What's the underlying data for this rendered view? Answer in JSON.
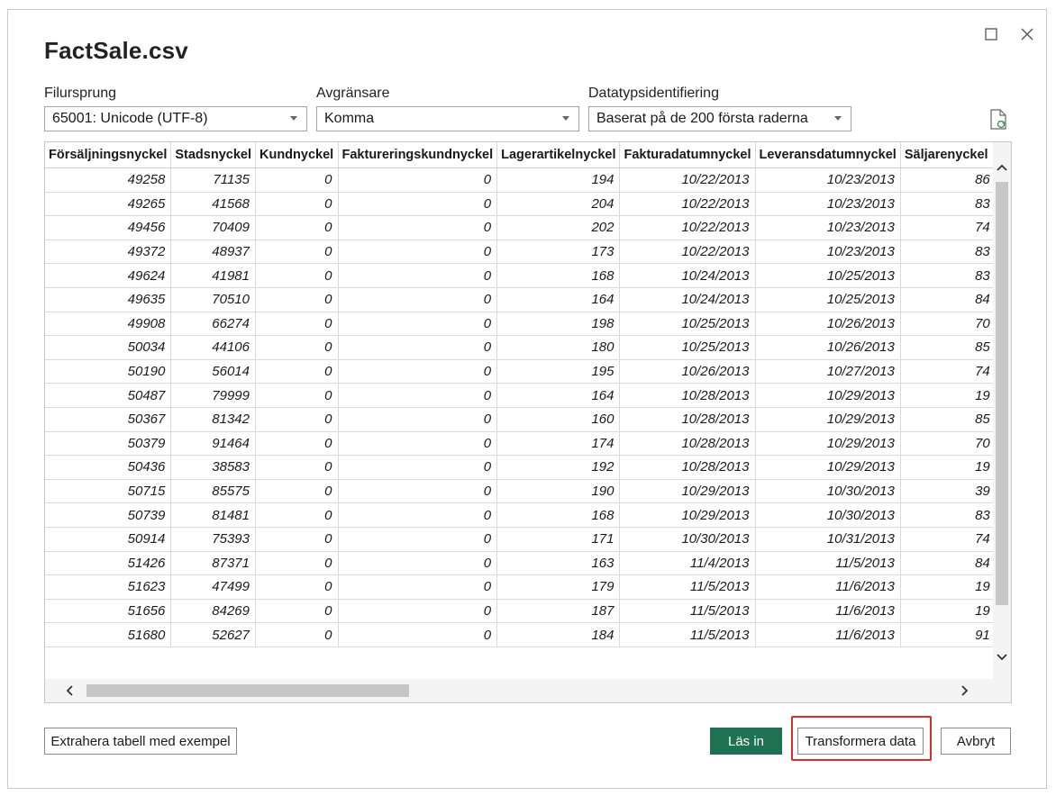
{
  "dialog": {
    "title": "FactSale.csv",
    "file_origin": {
      "label": "Filursprung",
      "value": "65001: Unicode (UTF-8)"
    },
    "delimiter": {
      "label": "Avgränsare",
      "value": "Komma"
    },
    "datatype_detection": {
      "label": "Datatypsidentifiering",
      "value": "Baserat på de 200 första raderna"
    }
  },
  "icons": {
    "maximize": "maximize-icon",
    "close": "close-icon",
    "refresh_file": "file-refresh-icon"
  },
  "colors": {
    "primary": "#1e7153",
    "highlight": "#d62d2d"
  },
  "table": {
    "columns": [
      "Försäljningsnyckel",
      "Stadsnyckel",
      "Kundnyckel",
      "Faktureringskundnyckel",
      "Lagerartikelnyckel",
      "Fakturadatumnyckel",
      "Leveransdatumnyckel",
      "Säljarenyckel"
    ],
    "rows": [
      [
        "49258",
        "71135",
        "0",
        "0",
        "194",
        "10/22/2013",
        "10/23/2013",
        "86"
      ],
      [
        "49265",
        "41568",
        "0",
        "0",
        "204",
        "10/22/2013",
        "10/23/2013",
        "83"
      ],
      [
        "49456",
        "70409",
        "0",
        "0",
        "202",
        "10/22/2013",
        "10/23/2013",
        "74"
      ],
      [
        "49372",
        "48937",
        "0",
        "0",
        "173",
        "10/22/2013",
        "10/23/2013",
        "83"
      ],
      [
        "49624",
        "41981",
        "0",
        "0",
        "168",
        "10/24/2013",
        "10/25/2013",
        "83"
      ],
      [
        "49635",
        "70510",
        "0",
        "0",
        "164",
        "10/24/2013",
        "10/25/2013",
        "84"
      ],
      [
        "49908",
        "66274",
        "0",
        "0",
        "198",
        "10/25/2013",
        "10/26/2013",
        "70"
      ],
      [
        "50034",
        "44106",
        "0",
        "0",
        "180",
        "10/25/2013",
        "10/26/2013",
        "85"
      ],
      [
        "50190",
        "56014",
        "0",
        "0",
        "195",
        "10/26/2013",
        "10/27/2013",
        "74"
      ],
      [
        "50487",
        "79999",
        "0",
        "0",
        "164",
        "10/28/2013",
        "10/29/2013",
        "19"
      ],
      [
        "50367",
        "81342",
        "0",
        "0",
        "160",
        "10/28/2013",
        "10/29/2013",
        "85"
      ],
      [
        "50379",
        "91464",
        "0",
        "0",
        "174",
        "10/28/2013",
        "10/29/2013",
        "70"
      ],
      [
        "50436",
        "38583",
        "0",
        "0",
        "192",
        "10/28/2013",
        "10/29/2013",
        "19"
      ],
      [
        "50715",
        "85575",
        "0",
        "0",
        "190",
        "10/29/2013",
        "10/30/2013",
        "39"
      ],
      [
        "50739",
        "81481",
        "0",
        "0",
        "168",
        "10/29/2013",
        "10/30/2013",
        "83"
      ],
      [
        "50914",
        "75393",
        "0",
        "0",
        "171",
        "10/30/2013",
        "10/31/2013",
        "74"
      ],
      [
        "51426",
        "87371",
        "0",
        "0",
        "163",
        "11/4/2013",
        "11/5/2013",
        "84"
      ],
      [
        "51623",
        "47499",
        "0",
        "0",
        "179",
        "11/5/2013",
        "11/6/2013",
        "19"
      ],
      [
        "51656",
        "84269",
        "0",
        "0",
        "187",
        "11/5/2013",
        "11/6/2013",
        "19"
      ],
      [
        "51680",
        "52627",
        "0",
        "0",
        "184",
        "11/5/2013",
        "11/6/2013",
        "91"
      ]
    ]
  },
  "buttons": {
    "extract": "Extrahera tabell med exempel",
    "load": "Läs in",
    "transform": "Transformera data",
    "cancel": "Avbryt"
  }
}
